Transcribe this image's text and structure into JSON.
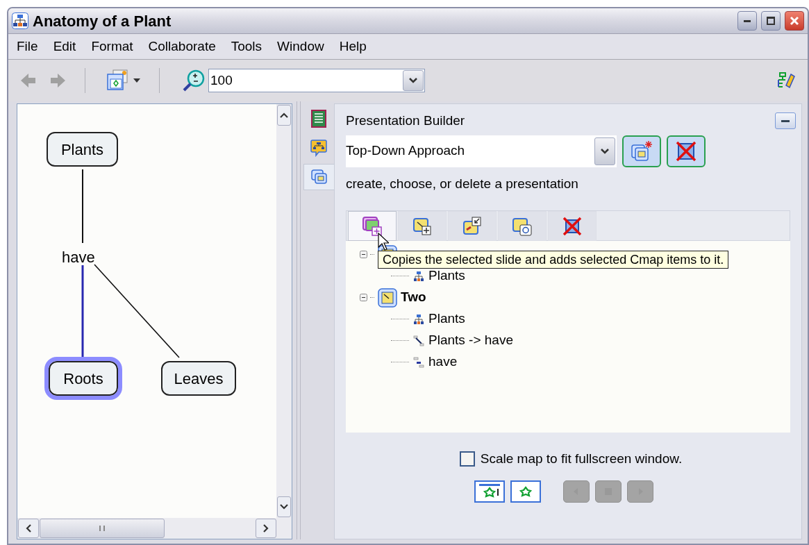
{
  "window": {
    "title": "Anatomy of a Plant"
  },
  "menu": [
    {
      "label": "File"
    },
    {
      "label": "Edit"
    },
    {
      "label": "Format"
    },
    {
      "label": "Collaborate"
    },
    {
      "label": "Tools"
    },
    {
      "label": "Window"
    },
    {
      "label": "Help"
    }
  ],
  "toolbar": {
    "zoom": "100"
  },
  "map": {
    "concepts": [
      {
        "label": "Plants",
        "selected": false
      },
      {
        "label": "Roots",
        "selected": true
      },
      {
        "label": "Leaves",
        "selected": false
      }
    ],
    "linking_phrase": {
      "label": "have"
    }
  },
  "side_tabs": [
    {
      "kind": "notes",
      "selected": false
    },
    {
      "kind": "chat",
      "selected": false
    },
    {
      "kind": "slides",
      "selected": true
    }
  ],
  "presentation_builder": {
    "title": "Presentation Builder",
    "presentation": "Top-Down Approach",
    "hint": "create, choose, or delete a presentation",
    "tool_buttons": [
      {
        "kind": "copy",
        "selected": true
      },
      {
        "kind": "add",
        "selected": false
      },
      {
        "kind": "zoom",
        "selected": false
      },
      {
        "kind": "update",
        "selected": false
      },
      {
        "kind": "delete",
        "selected": false
      }
    ],
    "tooltip": "Copies the selected slide and adds selected Cmap items to it.",
    "slides": [
      {
        "expanded": true,
        "children": [
          {
            "kind": "concept",
            "label": "Plants"
          }
        ]
      },
      {
        "label": "Two",
        "expanded": true,
        "children": [
          {
            "kind": "concept",
            "label": "Plants"
          },
          {
            "kind": "link",
            "label": "Plants -> have"
          },
          {
            "kind": "phrase",
            "label": "have"
          }
        ]
      }
    ],
    "scale_to_fit": {
      "label": "Scale map to fit fullscreen window.",
      "checked": false
    },
    "playback": [
      {
        "kind": "window",
        "disabled": false
      },
      {
        "kind": "fullscreen",
        "disabled": false
      },
      {
        "kind": "prev",
        "disabled": true
      },
      {
        "kind": "stop",
        "disabled": true
      },
      {
        "kind": "next",
        "disabled": true
      }
    ]
  }
}
